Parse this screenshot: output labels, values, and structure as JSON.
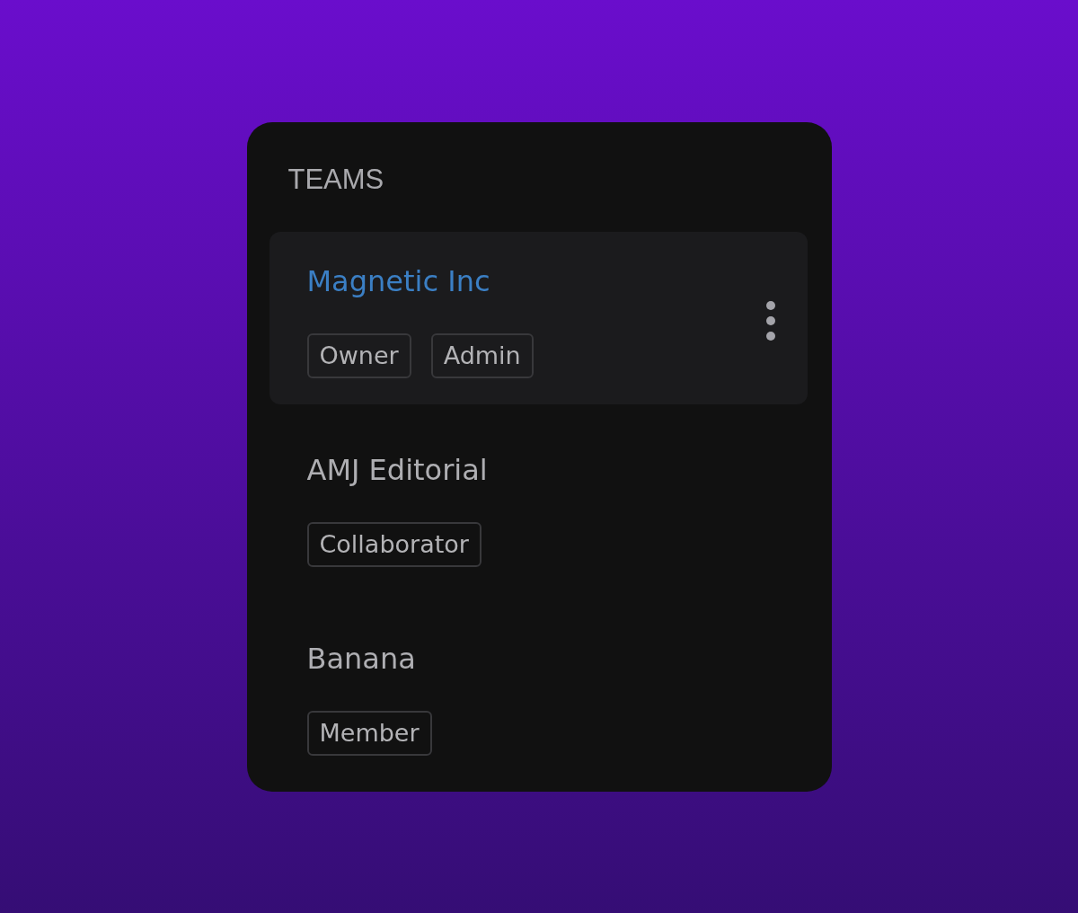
{
  "panel": {
    "title": "TEAMS"
  },
  "teams": [
    {
      "name": "Magnetic Inc",
      "selected": true,
      "roles": [
        "Owner",
        "Admin"
      ]
    },
    {
      "name": "AMJ Editorial",
      "selected": false,
      "roles": [
        "Collaborator"
      ]
    },
    {
      "name": "Banana",
      "selected": false,
      "roles": [
        "Member"
      ]
    }
  ]
}
